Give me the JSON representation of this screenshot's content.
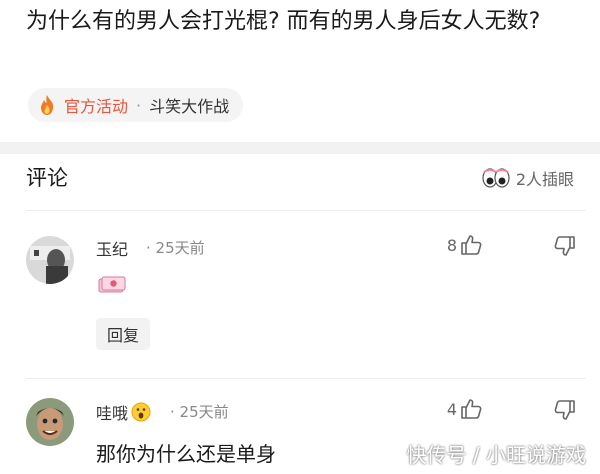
{
  "post": {
    "title": "为什么有的男人会打光棍? 而有的男人身后女人无数?",
    "tag_official": "官方活动",
    "tag_separator": "·",
    "tag_topic": "斗笑大作战"
  },
  "comments_section": {
    "title": "评论",
    "watchers_text": "2人插眼"
  },
  "comments": [
    {
      "username": "玉纪",
      "time": "· 25天前",
      "likes": "8",
      "reply_label": "回复"
    },
    {
      "username": "哇哦",
      "time": "· 25天前",
      "likes": "4",
      "text": "那你为什么还是单身"
    }
  ],
  "watermark": "快传号 / 小旺说游戏",
  "colors": {
    "accent_orange": "#e6553c",
    "background": "#ffffff",
    "divider": "#f2f2f2"
  },
  "icons": [
    "fire-icon",
    "eyes-icon",
    "thumbs-up-icon",
    "thumbs-down-icon",
    "money-emoji-icon",
    "surprised-emoji-icon"
  ]
}
